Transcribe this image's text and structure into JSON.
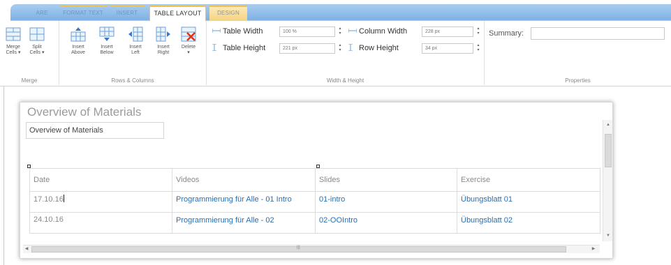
{
  "ribbon_tabs": [
    "ARE",
    "FORMAT TEXT",
    "INSERT",
    "TABLE LAYOUT",
    "DESIGN"
  ],
  "active_tab": "TABLE LAYOUT",
  "groups": {
    "merge": {
      "label": "Merge",
      "buttons": [
        {
          "line1": "Merge",
          "line2": "Cells ▾"
        },
        {
          "line1": "Split",
          "line2": "Cells ▾"
        }
      ]
    },
    "rows_columns": {
      "label": "Rows & Columns",
      "buttons": [
        {
          "line1": "Insert",
          "line2": "Above"
        },
        {
          "line1": "Insert",
          "line2": "Below"
        },
        {
          "line1": "Insert",
          "line2": "Left"
        },
        {
          "line1": "Insert",
          "line2": "Right"
        },
        {
          "line1": "Delete",
          "line2": "▾"
        }
      ]
    },
    "width_height": {
      "label": "Width & Height",
      "table_width_label": "Table Width",
      "table_width_value": "100 %",
      "table_height_label": "Table Height",
      "table_height_value": "221 px",
      "column_width_label": "Column Width",
      "column_width_value": "228 px",
      "row_height_label": "Row Height",
      "row_height_value": "34 px"
    },
    "properties": {
      "label": "Properties",
      "summary_label": "Summary:",
      "summary_value": ""
    }
  },
  "panel": {
    "title": "Overview of Materials",
    "title_input_value": "Overview of Materials"
  },
  "table": {
    "headers": [
      "Date",
      "Videos",
      "Slides",
      "Exercise"
    ],
    "rows": [
      {
        "date": "17.10.16",
        "video": "Programmierung für Alle - 01 Intro",
        "slides": "01-intro",
        "exercise": "Übungsblatt 01"
      },
      {
        "date": "24.10.16",
        "video": "Programmierung für Alle - 02",
        "slides": "02-OOIntro",
        "exercise": "Übungsblatt 02"
      }
    ]
  },
  "colors": {
    "tab_strip": "#8dbbe8",
    "context_accent": "#f2c14e",
    "link": "#2a6fb0"
  }
}
